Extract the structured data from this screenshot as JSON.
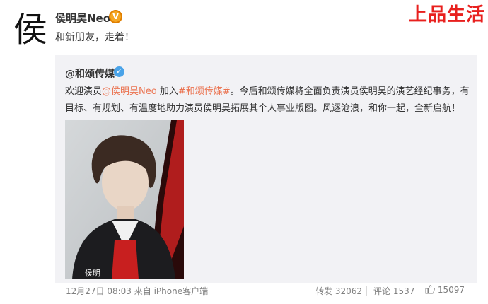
{
  "avatar_char": "侯",
  "user": {
    "name": "侯明昊Neo",
    "badge_icon": "v-verified-icon"
  },
  "watermark": "上品生活",
  "post": {
    "text": "和新朋友，走着！"
  },
  "repost": {
    "author": "@和颂传媒",
    "text_prefix": "欢迎演员",
    "mention": "@侯明昊Neo",
    "text_join": " 加入",
    "hashtag": "#和颂传媒#",
    "text_rest": "。今后和颂传媒将全面负责演员侯明昊的演艺经纪事务，有目标、有规划、有温度地助力演员侯明昊拓展其个人事业版图。风逐沧浪，和你一起，全新启航！",
    "photo_caption": "侯明"
  },
  "footer": {
    "time": "12月27日 08:03 来自 iPhone客户端",
    "repost_label": "转发 32062",
    "comment_label": "评论 1537",
    "like_count": "15097"
  },
  "colors": {
    "link": "#eb7350",
    "watermark": "#e8201e",
    "verify_gold": "#f5a623",
    "verify_blue": "#4aa3e8"
  }
}
